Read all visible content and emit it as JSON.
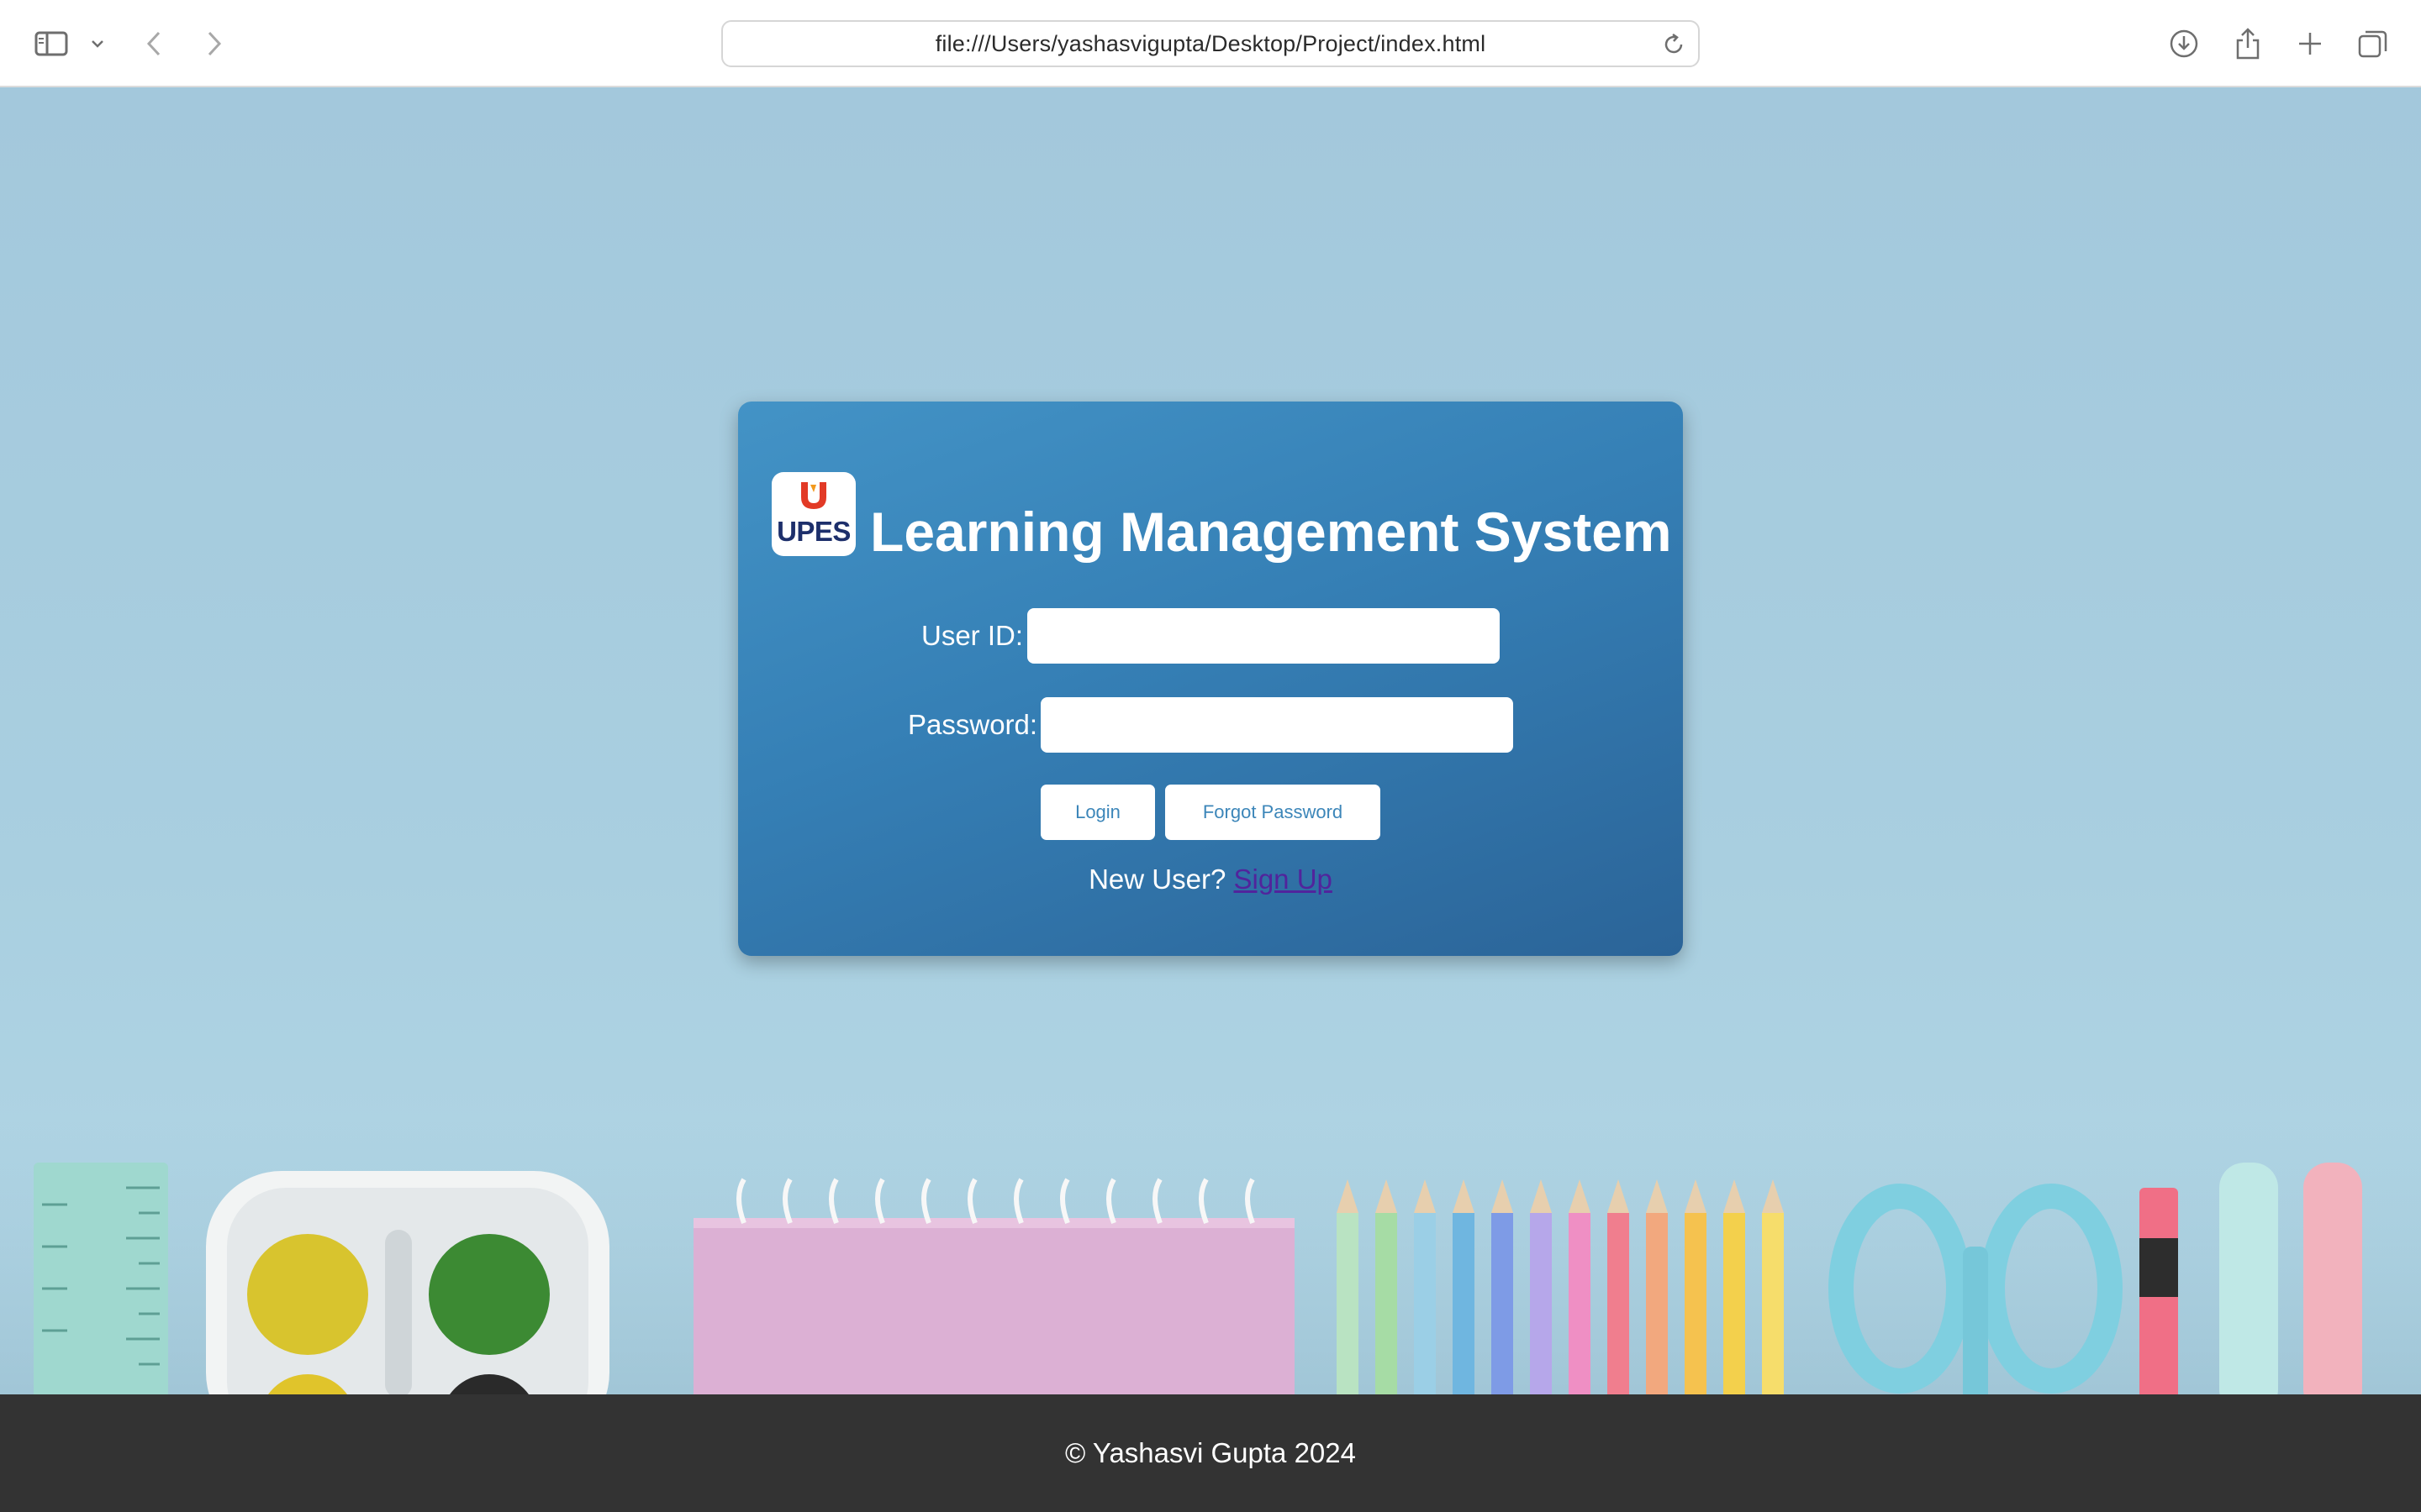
{
  "browser": {
    "url": "file:///Users/yashasvigupta/Desktop/Project/index.html",
    "icons": [
      "sidebar-icon",
      "chevron-down-icon",
      "back-icon",
      "forward-icon",
      "reload-icon",
      "download-icon",
      "share-icon",
      "new-tab-icon",
      "tab-overview-icon"
    ]
  },
  "login": {
    "logo_text": "UPES",
    "title": "Learning Management System",
    "user_id_label": "User ID:",
    "user_id_value": "",
    "password_label": "Password:",
    "password_value": "",
    "login_button": "Login",
    "forgot_button": "Forgot Password",
    "new_user_text": "New User?",
    "signup_link": "Sign Up"
  },
  "footer": {
    "text": "© Yashasvi Gupta 2024"
  },
  "colors": {
    "card_top": "#4393c6",
    "card_bottom": "#2b6498",
    "button_text": "#3c86b9",
    "link": "#51249c",
    "footer_bg": "#333333",
    "logo_navy": "#1d2f6b",
    "logo_red": "#e23a26"
  }
}
